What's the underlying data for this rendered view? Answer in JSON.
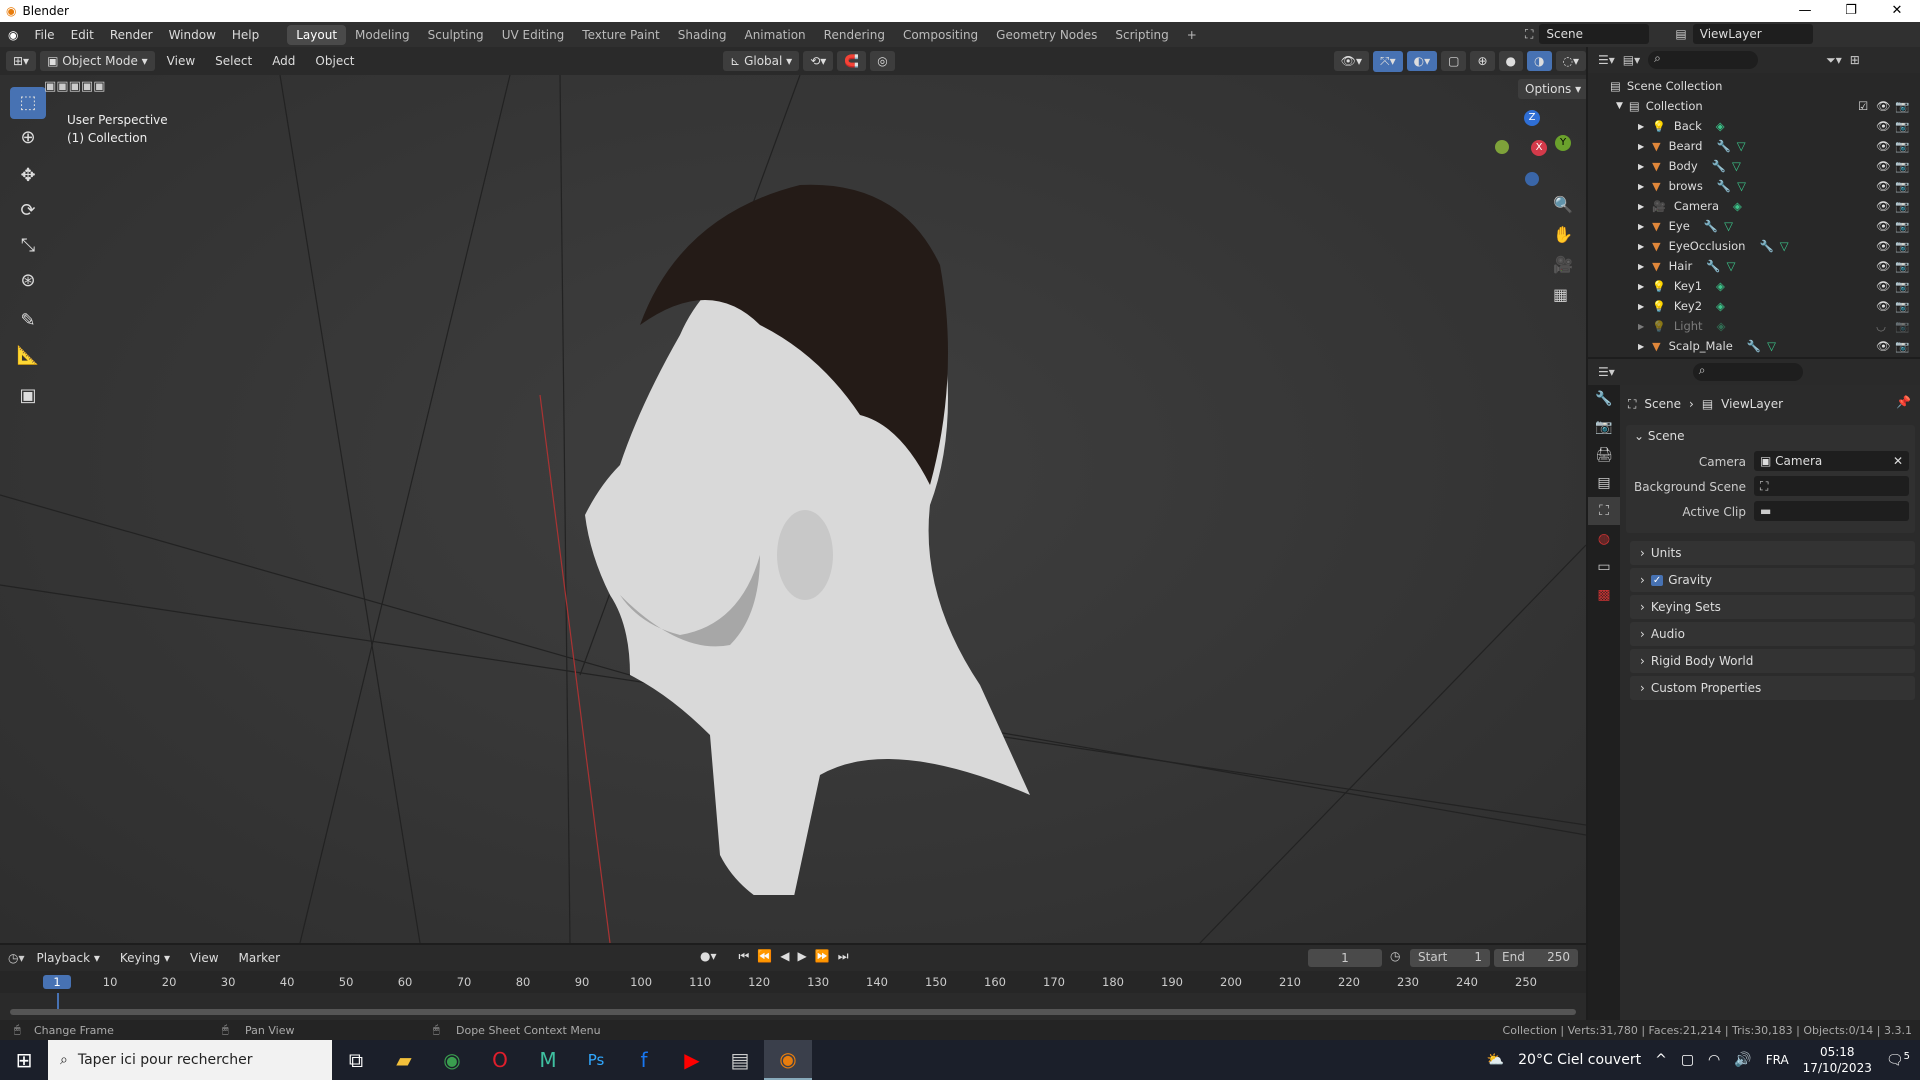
{
  "title": "Blender",
  "menu": [
    "File",
    "Edit",
    "Render",
    "Window",
    "Help"
  ],
  "workspaces": [
    "Layout",
    "Modeling",
    "Sculpting",
    "UV Editing",
    "Texture Paint",
    "Shading",
    "Animation",
    "Rendering",
    "Compositing",
    "Geometry Nodes",
    "Scripting"
  ],
  "scene_name": "Scene",
  "view_layer": "ViewLayer",
  "viewport": {
    "mode": "Object Mode",
    "menus": [
      "View",
      "Select",
      "Add",
      "Object"
    ],
    "orientation": "Global",
    "options": "Options",
    "overlay_line1": "User Perspective",
    "overlay_line2": "(1) Collection",
    "gizmo": {
      "x": "X",
      "y": "Y",
      "z": "Z"
    }
  },
  "outliner": {
    "root": "Scene Collection",
    "collection": "Collection",
    "items": [
      {
        "name": "Back",
        "type": "light"
      },
      {
        "name": "Beard",
        "type": "mesh"
      },
      {
        "name": "Body",
        "type": "mesh"
      },
      {
        "name": "brows",
        "type": "mesh"
      },
      {
        "name": "Camera",
        "type": "camera"
      },
      {
        "name": "Eye",
        "type": "mesh"
      },
      {
        "name": "EyeOcclusion",
        "type": "mesh"
      },
      {
        "name": "Hair",
        "type": "mesh"
      },
      {
        "name": "Key1",
        "type": "light"
      },
      {
        "name": "Key2",
        "type": "light"
      },
      {
        "name": "Light",
        "type": "light",
        "hidden": true
      },
      {
        "name": "Scalp_Male",
        "type": "mesh"
      }
    ]
  },
  "properties": {
    "breadcrumb_scene": "Scene",
    "breadcrumb_layer": "ViewLayer",
    "panel": "Scene",
    "camera_label": "Camera",
    "camera_value": "Camera",
    "bg_scene_label": "Background Scene",
    "active_clip_label": "Active Clip",
    "sections": [
      "Units",
      "Gravity",
      "Keying Sets",
      "Audio",
      "Rigid Body World",
      "Custom Properties"
    ],
    "gravity_checked": true
  },
  "timeline": {
    "menus": [
      "Playback",
      "Keying",
      "View",
      "Marker"
    ],
    "current_frame": "1",
    "start_label": "Start",
    "start": "1",
    "end_label": "End",
    "end": "250",
    "ticks": [
      "1",
      "10",
      "20",
      "30",
      "40",
      "50",
      "60",
      "70",
      "80",
      "90",
      "100",
      "110",
      "120",
      "130",
      "140",
      "150",
      "160",
      "170",
      "180",
      "190",
      "200",
      "210",
      "220",
      "230",
      "240",
      "250"
    ]
  },
  "status": {
    "left": "Change Frame",
    "middle": "Pan View",
    "right_hint": "Dope Sheet Context Menu",
    "stats": "Collection | Verts:31,780 | Faces:21,214 | Tris:30,183 | Objects:0/14 | 3.3.1"
  },
  "taskbar": {
    "search": "Taper ici pour rechercher",
    "weather": "20°C  Ciel couvert",
    "lang": "FRA",
    "time": "05:18",
    "date": "17/10/2023",
    "notifications": "5"
  }
}
